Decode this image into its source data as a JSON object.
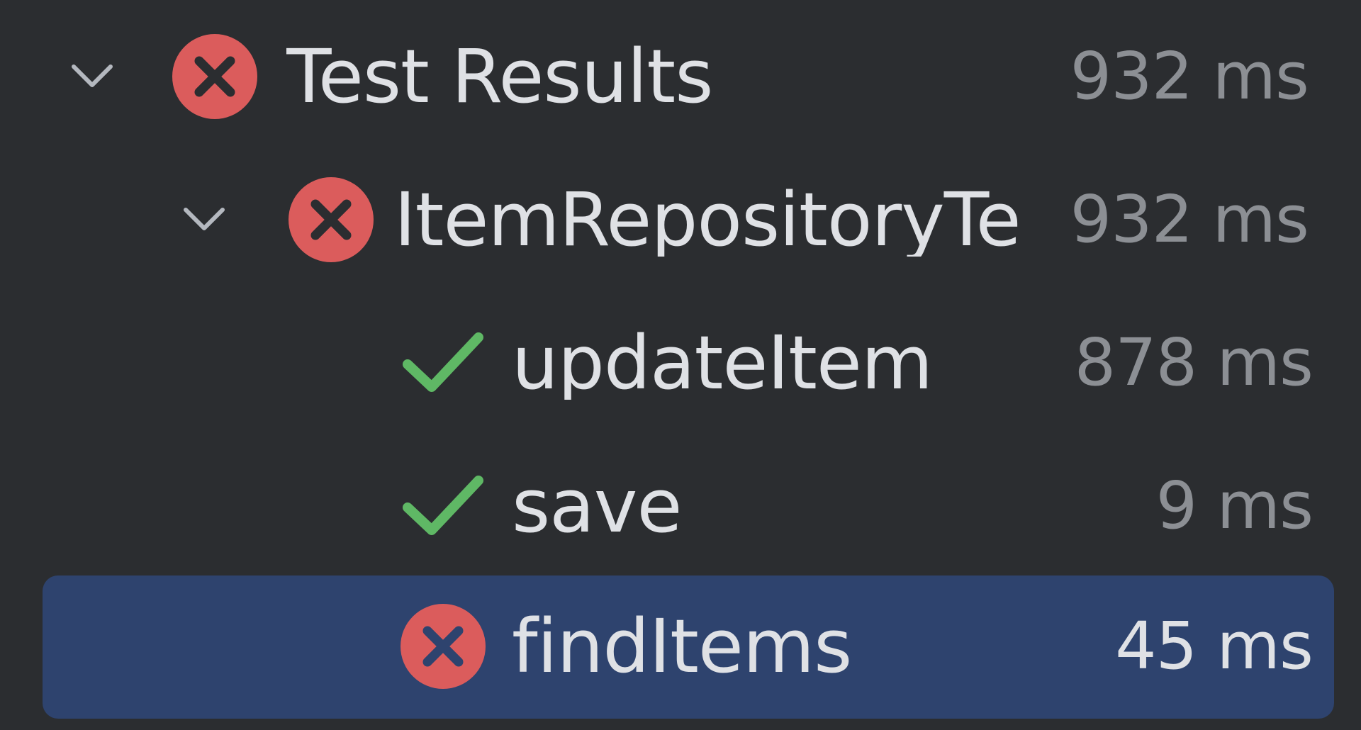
{
  "tree": {
    "rows": [
      {
        "label": "Test Results",
        "duration": "932 ms",
        "status": "failed",
        "expanded": true
      },
      {
        "label": "ItemRepositoryTe",
        "duration": "932 ms",
        "status": "failed",
        "expanded": true
      },
      {
        "label": "updateItem",
        "duration": "878 ms",
        "status": "passed"
      },
      {
        "label": "save",
        "duration": "9 ms",
        "status": "passed"
      },
      {
        "label": "findItems",
        "duration": "45 ms",
        "status": "failed",
        "selected": true
      }
    ]
  },
  "icons": {
    "expand": "chevron-down-icon",
    "failed": "error-x-icon",
    "passed": "checkmark-icon"
  },
  "colors": {
    "background": "#2b2d30",
    "selection": "#2e436e",
    "failed": "#db5c5c",
    "passed": "#5fb865",
    "text": "#dfe1e5",
    "muted": "#8c8f94"
  }
}
